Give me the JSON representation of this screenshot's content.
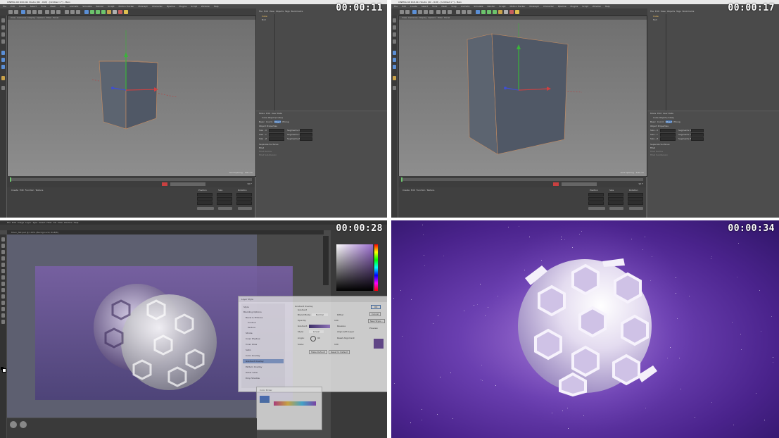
{
  "panels": [
    {
      "id": "q1",
      "timestamp": "00:00:11"
    },
    {
      "id": "q2",
      "timestamp": "00:00:17"
    },
    {
      "id": "q3",
      "timestamp": "00:00:28"
    },
    {
      "id": "q4",
      "timestamp": "00:00:34"
    }
  ],
  "c4d": {
    "title": "CINEMA 4D R18.011 Studio (RC - R18) - [Untitled 1 *] - Main",
    "menu": [
      "File",
      "Edit",
      "Create",
      "Select",
      "Tools",
      "Mesh",
      "Snap",
      "Animate",
      "Simulate",
      "Render",
      "Sculpt",
      "Motion Tracker",
      "MoGraph",
      "Character",
      "Pipeline",
      "Plugins",
      "Script",
      "Window",
      "Help"
    ],
    "viewport_menu": [
      "View",
      "Cameras",
      "Display",
      "Options",
      "Filter",
      "Panel"
    ],
    "grid_spacing": "Grid Spacing : 100 cm",
    "objects_menu": [
      "File",
      "Edit",
      "View",
      "Objects",
      "Tags",
      "Bookmarks"
    ],
    "objects": [
      "Cube",
      "Null"
    ],
    "attr_menu": [
      "Mode",
      "Edit",
      "User Data"
    ],
    "attr_title": "Cube Object [Cube]",
    "attr_tabs": [
      "Basic",
      "Coord.",
      "Object",
      "Phong"
    ],
    "object_properties": "Object Properties",
    "size_rows": [
      {
        "label": "Size . X",
        "value": "174 cm",
        "seg": "Segments X",
        "segval": "1"
      },
      {
        "label": "Size . Y",
        "value": "200 cm",
        "seg": "Segments Y",
        "segval": "1"
      },
      {
        "label": "Size . Z",
        "value": "200 cm",
        "seg": "Segments Z",
        "segval": "1"
      }
    ],
    "sep_surfaces": "Separate Surfaces",
    "fillet": "Fillet",
    "fillet_radius": "Fillet Radius",
    "fillet_subdiv": "Fillet Subdivision",
    "timeline_end": "90 F",
    "bottom_menu": [
      "Create",
      "Edit",
      "Function",
      "Texture"
    ],
    "coord_headers": [
      "Position",
      "Size",
      "Rotation"
    ],
    "coord_rows": [
      {
        "axis": "X",
        "pos": "0 cm",
        "size": "174 cm",
        "rot": "H 0°"
      },
      {
        "axis": "Y",
        "pos": "0 cm",
        "size": "200 cm",
        "rot": "P 0°"
      },
      {
        "axis": "Z",
        "pos": "0 cm",
        "size": "200 cm",
        "rot": "B 0°"
      }
    ],
    "coord_mode": "Object (Rel)",
    "coord_size_mode": "Size",
    "apply": "Apply"
  },
  "ps": {
    "menu": [
      "File",
      "Edit",
      "Image",
      "Layer",
      "Type",
      "Select",
      "Filter",
      "3D",
      "View",
      "Window",
      "Help"
    ],
    "tab": "Moon_flat.psd @ 100% (Background, RGB/8)",
    "layer_style": {
      "title": "Layer Style",
      "styles": [
        "Style",
        "Blending Options",
        "Bevel & Emboss",
        "Contour",
        "Texture",
        "Stroke",
        "Inner Shadow",
        "Inner Glow",
        "Satin",
        "Color Overlay",
        "Gradient Overlay",
        "Pattern Overlay",
        "Outer Glow",
        "Drop Shadow"
      ],
      "section": "Gradient Overlay",
      "sub": "Gradient",
      "blend_mode_label": "Blend Mode:",
      "blend_mode": "Normal",
      "dither": "Dither",
      "opacity_label": "Opacity:",
      "opacity": "100",
      "gradient_label": "Gradient:",
      "reverse": "Reverse",
      "style_label": "Style:",
      "style": "Linear",
      "align": "Align with Layer",
      "angle_label": "Angle:",
      "angle": "90",
      "reset_align": "Reset Alignment",
      "scale_label": "Scale:",
      "scale": "100",
      "make_default": "Make Default",
      "reset_default": "Reset to Default",
      "ok": "OK",
      "cancel": "Cancel",
      "new_style": "New Style...",
      "preview": "Preview"
    },
    "color_picker_title": "Color Picker",
    "gradient_editor": "Gradient Editor"
  },
  "accent": "#3e6fb0"
}
